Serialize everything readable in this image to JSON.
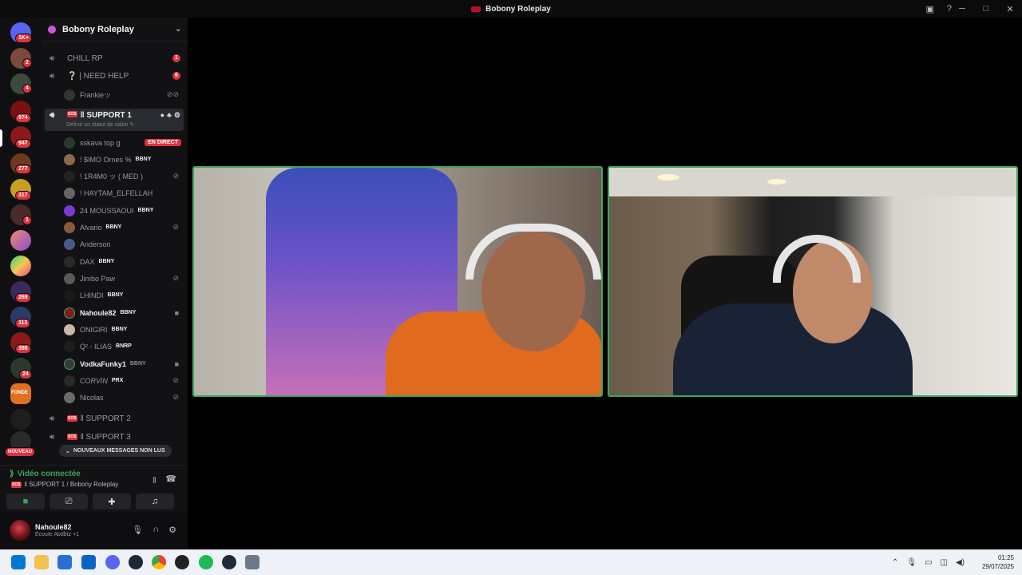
{
  "window": {
    "title": "Bobony Roleplay"
  },
  "rail": {
    "badges": [
      "1K+",
      "2",
      "4",
      "974",
      "947",
      "277",
      "317",
      "1",
      "269",
      "113",
      "398",
      "24"
    ],
    "new_label": "NOUVEAU",
    "fondue_label": "FONDE"
  },
  "guild": {
    "name": "Bobony Roleplay"
  },
  "channels": [
    {
      "name": "CHILL RP",
      "count": "1"
    },
    {
      "name": "❔ | NEED HELP",
      "count": "6"
    }
  ],
  "frankie": "Frankieッ",
  "active_channel": {
    "name": "‖ SUPPORT 1",
    "sub": "Définir un statut de salon ✎"
  },
  "users": [
    {
      "name": "sskava top g",
      "tag": "",
      "live": "EN DIRECT"
    },
    {
      "name": "! $IMO Ornes %",
      "tag": "BBNY"
    },
    {
      "name": "! 1R4M0 ッ ( MED )",
      "tag": ""
    },
    {
      "name": "! HAYTAM_ELFELLAH",
      "tag": ""
    },
    {
      "name": "24 MOUSSAOUI",
      "tag": "BBNY"
    },
    {
      "name": "Alvario",
      "tag": "BBNY"
    },
    {
      "name": "Anderson",
      "tag": ""
    },
    {
      "name": "DAX",
      "tag": "BBNY"
    },
    {
      "name": "Jimbo Paw",
      "tag": ""
    },
    {
      "name": "LHINDI",
      "tag": "BBNY"
    },
    {
      "name": "Nahoule82",
      "tag": "BBNY"
    },
    {
      "name": "ONIGIRI",
      "tag": "BBNY"
    },
    {
      "name": "Q² - ILIAS",
      "tag": "BNRP"
    },
    {
      "name": "VodkaFunky1",
      "tag": "BBNY"
    },
    {
      "name": "CORVIN",
      "tag": "PRX"
    },
    {
      "name": "Nicolas",
      "tag": ""
    }
  ],
  "channels_after": [
    {
      "name": "‖ SUPPORT 2"
    },
    {
      "name": "‖ SUPPORT 3"
    }
  ],
  "new_messages": "NOUVEAUX MESSAGES NON LUS",
  "voice": {
    "status": "Vidéo connectée",
    "location": "‖ SUPPORT 1 / Bobony Roleplay"
  },
  "user_panel": {
    "name": "Nahoule82",
    "status": "Écoute Abdbtz +1"
  },
  "clock": {
    "time": "01:25",
    "date": "29/07/2025"
  }
}
